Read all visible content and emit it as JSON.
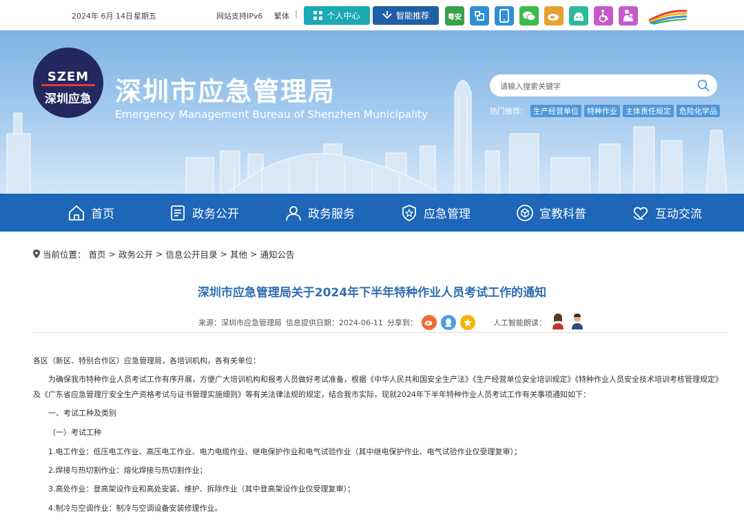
{
  "topbar": {
    "date": "2024年 6月 14日",
    "weekday": "星期五",
    "ipv6": "网站支持IPv6",
    "traditional": "繁体",
    "separator": "|",
    "personal_center": "个人中心",
    "smart_recommend": "智能推荐",
    "icons": [
      "guardian-icon",
      "app-icon",
      "mobile-icon",
      "wechat-icon",
      "weibo-icon",
      "robot-icon",
      "accessibility-icon",
      "elderly-icon"
    ],
    "guardian_text": "粤安"
  },
  "header": {
    "emblem_top": "SZEM",
    "emblem_bottom": "深圳应急",
    "title": "深圳市应急管理局",
    "subtitle": "Emergency Management Bureau of Shenzhen Municipality"
  },
  "search": {
    "placeholder": "请输入搜索关键字",
    "hot_label": "热门推荐：",
    "hot_tags": [
      "生产经营单位",
      "特种作业",
      "主体责任规定",
      "危险化学品"
    ]
  },
  "nav": {
    "items": [
      {
        "label": "首页",
        "icon": "home-icon"
      },
      {
        "label": "政务公开",
        "icon": "document-icon"
      },
      {
        "label": "政务服务",
        "icon": "user-icon"
      },
      {
        "label": "应急管理",
        "icon": "shield-icon"
      },
      {
        "label": "宣教科普",
        "icon": "cube-icon"
      },
      {
        "label": "互动交流",
        "icon": "heart-hand-icon"
      }
    ]
  },
  "breadcrumb": {
    "label": "当前位置：",
    "items": [
      "首页",
      "政务公开",
      "信息公开目录",
      "其他",
      "通知公告"
    ]
  },
  "article": {
    "title": "深圳市应急管理局关于2024年下半年特种作业人员考试工作的通知",
    "source": "来源：深圳市应急管理局",
    "date": "信息提供日期：2024-06-11",
    "share_label": "分享到：",
    "ai_read": "人工智能朗读：",
    "paragraphs": [
      "各区（新区、特别合作区）应急管理局，各培训机构，各有关单位：",
      "为确保我市特种作业人员考试工作有序开展，方便广大培训机构和报考人员做好考试准备，根据《中华人民共和国安全生产法》《生产经营单位安全培训规定》《特种作业人员安全技术培训考核管理规定》及《广东省应急管理厅安全生产资格考试与证书管理实施细则》等有关法律法规的规定，结合我市实际，现就2024年下半年特种作业人员考试工作有关事项通知如下：",
      "一、考试工种及类别",
      "（一）考试工种",
      "1.电工作业：低压电工作业、高压电工作业、电力电缆作业、继电保护作业和电气试验作业（其中继电保护作业、电气试验作业仅受理复审）；",
      "2.焊接与热切割作业：熔化焊接与热切割作业；",
      "3.高处作业：登高架设作业和高处安装、维护、拆除作业（其中登高架设作业仅受理复审）；",
      "4.制冷与空调作业：制冷与空调设备安装修理作业。"
    ]
  },
  "colors": {
    "nav_bg": "#1d66b8",
    "title_blue": "#2f6db3",
    "teal": "#1aa9b5",
    "banner_sky": "#8ec0ea"
  }
}
